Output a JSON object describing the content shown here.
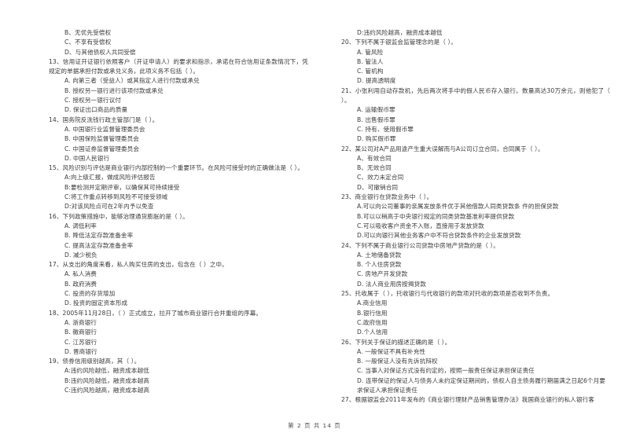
{
  "document": {
    "footer": "第 2 页  共 14 页",
    "page_number": "2",
    "total_pages": "14"
  },
  "left_column": {
    "items": [
      {
        "type": "option",
        "text": "B、无优先受偿权"
      },
      {
        "type": "option",
        "text": "C、不享有受偿权"
      },
      {
        "type": "option",
        "text": "D、与其他债权人共同受偿"
      },
      {
        "type": "stem",
        "text": "13、信用证开证银行依照客户（开证申请人）的要求和指示，承诺在符合信用证条款情况下，凭规定的单据承担付款或承兑义务，此项义务不包括（    ）。"
      },
      {
        "type": "option",
        "text": "A. 向第三者（受益人）或其指定人进行付款或承兑"
      },
      {
        "type": "option",
        "text": "B. 授权另一银行进行该项付款或承兑"
      },
      {
        "type": "option",
        "text": "C. 授权另一银行议付"
      },
      {
        "type": "option",
        "text": "D. 保证出口商品的质量"
      },
      {
        "type": "stem",
        "text": "14、国务院反洗钱行政主管部门是（    ）。"
      },
      {
        "type": "option",
        "text": "A. 中国银行业监督管理委员会"
      },
      {
        "type": "option",
        "text": "B. 中国保险监督管理委员会"
      },
      {
        "type": "option",
        "text": "C. 中国证券监督管理委员会"
      },
      {
        "type": "option",
        "text": "D. 中国人民银行"
      },
      {
        "type": "stem",
        "text": "15、风险识别与评估是商业银行内部控制的一个重要环节。在风险可接受时的正确做法是（    ）。"
      },
      {
        "type": "option",
        "text": "A:向上级汇报，做成风险评估报告"
      },
      {
        "type": "option",
        "text": "B:要检测并定期评审，以确保其可持续接受"
      },
      {
        "type": "option",
        "text": "C:将工作重点转移到风险不可接受领域"
      },
      {
        "type": "option",
        "text": "D:对该风险点可在2年内予以免查"
      },
      {
        "type": "stem",
        "text": "16、下列政策措施中，能够治理通货膨胀的是（    ）。"
      },
      {
        "type": "option",
        "text": "A. 调低利率"
      },
      {
        "type": "option",
        "text": "B. 降低法定存款准备金率"
      },
      {
        "type": "option",
        "text": "C. 提高法定存款准备金率"
      },
      {
        "type": "option",
        "text": "D. 减少税负"
      },
      {
        "type": "stem",
        "text": "17、从支出的角度来看，私人购买住房的支出，包含在（      ）之中。"
      },
      {
        "type": "option",
        "text": "A. 私人消费"
      },
      {
        "type": "option",
        "text": "B. 政府消费"
      },
      {
        "type": "option",
        "text": "C. 投资的存货增加"
      },
      {
        "type": "option",
        "text": "D. 投资的固定资本形成"
      },
      {
        "type": "stem",
        "text": "18、2005年11月28日，（    ）正式成立，拉开了城市商业银行合并重组的序幕。"
      },
      {
        "type": "option",
        "text": "A.  浙商银行"
      },
      {
        "type": "option",
        "text": "B.  徽商银行"
      },
      {
        "type": "option",
        "text": "C.  江苏银行"
      },
      {
        "type": "option",
        "text": "D.  晋商银行"
      },
      {
        "type": "stem",
        "text": "19、债券信用级别越高，其（     ）。"
      },
      {
        "type": "option",
        "text": "A:违约风险越低，融资成本越低"
      },
      {
        "type": "option",
        "text": "B:违约风险越低，融资成本越高"
      },
      {
        "type": "option",
        "text": "C:违约风险越高，融资成本越高"
      }
    ]
  },
  "right_column": {
    "items": [
      {
        "type": "option",
        "text": "D:违约风险越高，融资成本越低"
      },
      {
        "type": "stem",
        "text": "20、下列不属于银监会监管理念的是（    ）。"
      },
      {
        "type": "option",
        "text": "A. 管风险"
      },
      {
        "type": "option",
        "text": "B. 管法人"
      },
      {
        "type": "option",
        "text": "C. 管机构"
      },
      {
        "type": "option",
        "text": "D. 提高透明度"
      },
      {
        "type": "stem",
        "text": "21、小张利用自动存款机，先后两次将手中的假人民币存入银行。数量高达30万余元，则他犯了（    ）。"
      },
      {
        "type": "option",
        "text": "A.  运输假币罪"
      },
      {
        "type": "option",
        "text": "B.  出售假币罪"
      },
      {
        "type": "option",
        "text": "C.  持有、使用假币罪"
      },
      {
        "type": "option",
        "text": "D.  购买假币罪"
      },
      {
        "type": "stem",
        "text": "22、某公司对A产品用途产生重大误解而与A公司订立合同，合同属于（     ）。"
      },
      {
        "type": "option",
        "text": "A、有效合同"
      },
      {
        "type": "option",
        "text": "B、无效合同"
      },
      {
        "type": "option",
        "text": "C、效力未定合同"
      },
      {
        "type": "option",
        "text": "D、可撤销合同"
      },
      {
        "type": "stem",
        "text": "23、商业银行在贷款业务中（     ）。"
      },
      {
        "type": "option",
        "text": "A.可以向公司董事的亲属发放条件优于其他借款人同类贷款条 件的担保贷款"
      },
      {
        "type": "option",
        "text": "B.可以以稍高于中央银行规定的同类贷款基准利率提供贷款"
      },
      {
        "type": "option",
        "text": "C.可以吸收客户资金不入账，直接用于发放贷款"
      },
      {
        "type": "option",
        "text": "D.可以向银行其他业务客户中不符合贷款条件的企业发放贷款"
      },
      {
        "type": "stem",
        "text": "24、下列不属于商业银行公司贷款中房地产贷款的是（     ）。"
      },
      {
        "type": "option",
        "text": "A.  土地储备贷款"
      },
      {
        "type": "option",
        "text": "B.  个人住房贷款"
      },
      {
        "type": "option",
        "text": "C.  房地产开发贷款"
      },
      {
        "type": "option",
        "text": "D.  法人商业用房按揭贷款"
      },
      {
        "type": "stem",
        "text": "25、托收属于（     ），托收银行与代收银行的款项对托收的款项是否收到不负责。"
      },
      {
        "type": "option",
        "text": "A.商业信用"
      },
      {
        "type": "option",
        "text": "B.银行信用"
      },
      {
        "type": "option",
        "text": "C.政府信用"
      },
      {
        "type": "option",
        "text": "D.个人信用"
      },
      {
        "type": "stem",
        "text": "26、下列关于保证的描述正确的是（     ）。"
      },
      {
        "type": "option",
        "text": "A.  一般保证不具有补充性"
      },
      {
        "type": "option",
        "text": "B.  一般保证人没有先诉抗辩权"
      },
      {
        "type": "option",
        "text": "C.  当事人对保证方式没有约定的，按照一般责任保证承担保证责任"
      },
      {
        "type": "option",
        "text": "D.  连带保证的保证人与债务人未约定保证期间的，债权人自主债务履行期届满之日起6个月要求保证人承担保证责任"
      },
      {
        "type": "stem",
        "text": "27、根据银监会2011年发布的《商业银行理财产品销售管理办法》我国商业银行的私人银行客"
      }
    ]
  }
}
